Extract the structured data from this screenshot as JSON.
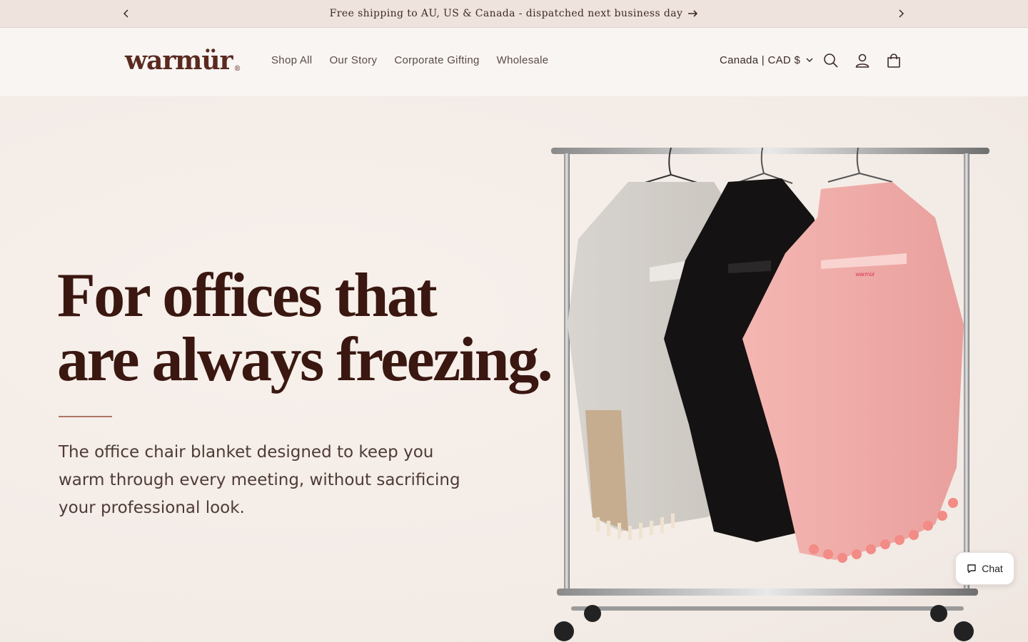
{
  "announcement": {
    "message": "Free shipping to AU, US & Canada - dispatched next business day",
    "prev_icon": "chevron-left-icon",
    "next_icon": "chevron-right-icon"
  },
  "header": {
    "logo": "warmür",
    "logo_mark": "®",
    "nav": [
      {
        "label": "Shop All"
      },
      {
        "label": "Our Story"
      },
      {
        "label": "Corporate Gifting"
      },
      {
        "label": "Wholesale"
      }
    ],
    "locale": "Canada | CAD $",
    "icons": [
      "search-icon",
      "account-icon",
      "cart-icon"
    ]
  },
  "hero": {
    "headline_line1": "For offices that",
    "headline_line2": "are always freezing.",
    "subtext": "The office chair blanket designed to keep you warm through every meeting, without sacrificing your professional look."
  },
  "chat": {
    "label": "Chat"
  },
  "colors": {
    "brand": "#5a2a1f",
    "announcement_bg": "#efe3dd",
    "hero_bg": "#f3ebe6",
    "accent_line": "#b07564"
  }
}
